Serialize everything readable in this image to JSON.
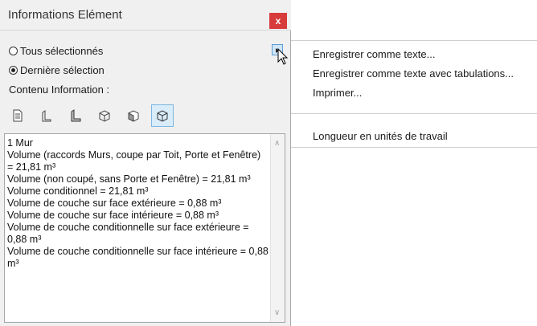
{
  "window": {
    "title": "Informations Elément",
    "close_label": "x"
  },
  "selection": {
    "options": [
      {
        "label": "Tous sélectionnés",
        "checked": false
      },
      {
        "label": "Dernière sélection",
        "checked": true
      }
    ]
  },
  "content_label": "Contenu Information :",
  "toolbar": {
    "icons": [
      "document-icon",
      "wall-profile-icon",
      "wall-side-icon",
      "cube-icon",
      "cube-face-icon",
      "cube-selected-icon"
    ],
    "selected_index": 5
  },
  "info": {
    "lines": [
      "1 Mur",
      "Volume (raccords Murs, coupe par Toit, Porte et Fenêtre) = 21,81 m³",
      "Volume (non coupé, sans Porte et Fenêtre) = 21,81 m³",
      "Volume conditionnel = 21,81 m³",
      "Volume de couche sur face extérieure = 0,88 m³",
      "Volume de couche sur face intérieure = 0,88 m³",
      "Volume de couche conditionnelle sur face extérieure = 0,88 m³",
      "Volume de couche conditionnelle sur face intérieure = 0,88 m³"
    ]
  },
  "menu": {
    "items": [
      "Enregistrer comme texte...",
      "Enregistrer comme texte avec tabulations...",
      "Imprimer...",
      "Longueur en unités de travail"
    ]
  },
  "colors": {
    "close": "#d83b3b",
    "selected_tool": "#d8ecf9",
    "accent": "#5b9bd5"
  }
}
